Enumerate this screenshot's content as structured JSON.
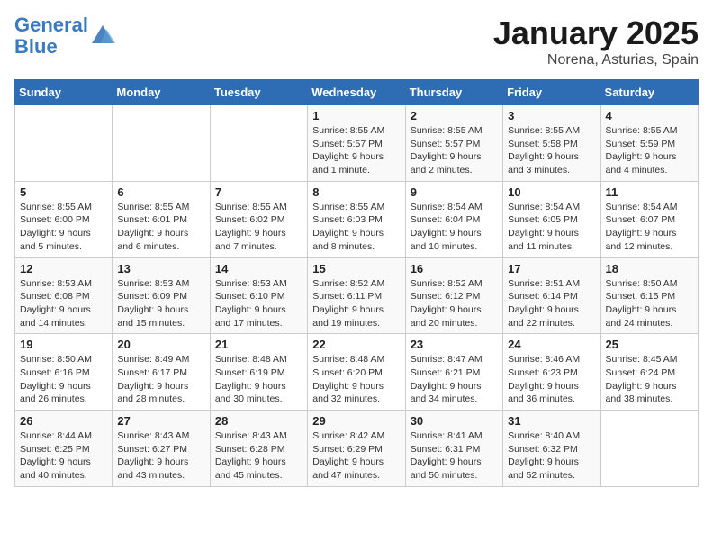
{
  "logo": {
    "line1": "General",
    "line2": "Blue"
  },
  "title": "January 2025",
  "location": "Norena, Asturias, Spain",
  "weekdays": [
    "Sunday",
    "Monday",
    "Tuesday",
    "Wednesday",
    "Thursday",
    "Friday",
    "Saturday"
  ],
  "weeks": [
    [
      {
        "day": "",
        "info": ""
      },
      {
        "day": "",
        "info": ""
      },
      {
        "day": "",
        "info": ""
      },
      {
        "day": "1",
        "info": "Sunrise: 8:55 AM\nSunset: 5:57 PM\nDaylight: 9 hours\nand 1 minute."
      },
      {
        "day": "2",
        "info": "Sunrise: 8:55 AM\nSunset: 5:57 PM\nDaylight: 9 hours\nand 2 minutes."
      },
      {
        "day": "3",
        "info": "Sunrise: 8:55 AM\nSunset: 5:58 PM\nDaylight: 9 hours\nand 3 minutes."
      },
      {
        "day": "4",
        "info": "Sunrise: 8:55 AM\nSunset: 5:59 PM\nDaylight: 9 hours\nand 4 minutes."
      }
    ],
    [
      {
        "day": "5",
        "info": "Sunrise: 8:55 AM\nSunset: 6:00 PM\nDaylight: 9 hours\nand 5 minutes."
      },
      {
        "day": "6",
        "info": "Sunrise: 8:55 AM\nSunset: 6:01 PM\nDaylight: 9 hours\nand 6 minutes."
      },
      {
        "day": "7",
        "info": "Sunrise: 8:55 AM\nSunset: 6:02 PM\nDaylight: 9 hours\nand 7 minutes."
      },
      {
        "day": "8",
        "info": "Sunrise: 8:55 AM\nSunset: 6:03 PM\nDaylight: 9 hours\nand 8 minutes."
      },
      {
        "day": "9",
        "info": "Sunrise: 8:54 AM\nSunset: 6:04 PM\nDaylight: 9 hours\nand 10 minutes."
      },
      {
        "day": "10",
        "info": "Sunrise: 8:54 AM\nSunset: 6:05 PM\nDaylight: 9 hours\nand 11 minutes."
      },
      {
        "day": "11",
        "info": "Sunrise: 8:54 AM\nSunset: 6:07 PM\nDaylight: 9 hours\nand 12 minutes."
      }
    ],
    [
      {
        "day": "12",
        "info": "Sunrise: 8:53 AM\nSunset: 6:08 PM\nDaylight: 9 hours\nand 14 minutes."
      },
      {
        "day": "13",
        "info": "Sunrise: 8:53 AM\nSunset: 6:09 PM\nDaylight: 9 hours\nand 15 minutes."
      },
      {
        "day": "14",
        "info": "Sunrise: 8:53 AM\nSunset: 6:10 PM\nDaylight: 9 hours\nand 17 minutes."
      },
      {
        "day": "15",
        "info": "Sunrise: 8:52 AM\nSunset: 6:11 PM\nDaylight: 9 hours\nand 19 minutes."
      },
      {
        "day": "16",
        "info": "Sunrise: 8:52 AM\nSunset: 6:12 PM\nDaylight: 9 hours\nand 20 minutes."
      },
      {
        "day": "17",
        "info": "Sunrise: 8:51 AM\nSunset: 6:14 PM\nDaylight: 9 hours\nand 22 minutes."
      },
      {
        "day": "18",
        "info": "Sunrise: 8:50 AM\nSunset: 6:15 PM\nDaylight: 9 hours\nand 24 minutes."
      }
    ],
    [
      {
        "day": "19",
        "info": "Sunrise: 8:50 AM\nSunset: 6:16 PM\nDaylight: 9 hours\nand 26 minutes."
      },
      {
        "day": "20",
        "info": "Sunrise: 8:49 AM\nSunset: 6:17 PM\nDaylight: 9 hours\nand 28 minutes."
      },
      {
        "day": "21",
        "info": "Sunrise: 8:48 AM\nSunset: 6:19 PM\nDaylight: 9 hours\nand 30 minutes."
      },
      {
        "day": "22",
        "info": "Sunrise: 8:48 AM\nSunset: 6:20 PM\nDaylight: 9 hours\nand 32 minutes."
      },
      {
        "day": "23",
        "info": "Sunrise: 8:47 AM\nSunset: 6:21 PM\nDaylight: 9 hours\nand 34 minutes."
      },
      {
        "day": "24",
        "info": "Sunrise: 8:46 AM\nSunset: 6:23 PM\nDaylight: 9 hours\nand 36 minutes."
      },
      {
        "day": "25",
        "info": "Sunrise: 8:45 AM\nSunset: 6:24 PM\nDaylight: 9 hours\nand 38 minutes."
      }
    ],
    [
      {
        "day": "26",
        "info": "Sunrise: 8:44 AM\nSunset: 6:25 PM\nDaylight: 9 hours\nand 40 minutes."
      },
      {
        "day": "27",
        "info": "Sunrise: 8:43 AM\nSunset: 6:27 PM\nDaylight: 9 hours\nand 43 minutes."
      },
      {
        "day": "28",
        "info": "Sunrise: 8:43 AM\nSunset: 6:28 PM\nDaylight: 9 hours\nand 45 minutes."
      },
      {
        "day": "29",
        "info": "Sunrise: 8:42 AM\nSunset: 6:29 PM\nDaylight: 9 hours\nand 47 minutes."
      },
      {
        "day": "30",
        "info": "Sunrise: 8:41 AM\nSunset: 6:31 PM\nDaylight: 9 hours\nand 50 minutes."
      },
      {
        "day": "31",
        "info": "Sunrise: 8:40 AM\nSunset: 6:32 PM\nDaylight: 9 hours\nand 52 minutes."
      },
      {
        "day": "",
        "info": ""
      }
    ]
  ]
}
